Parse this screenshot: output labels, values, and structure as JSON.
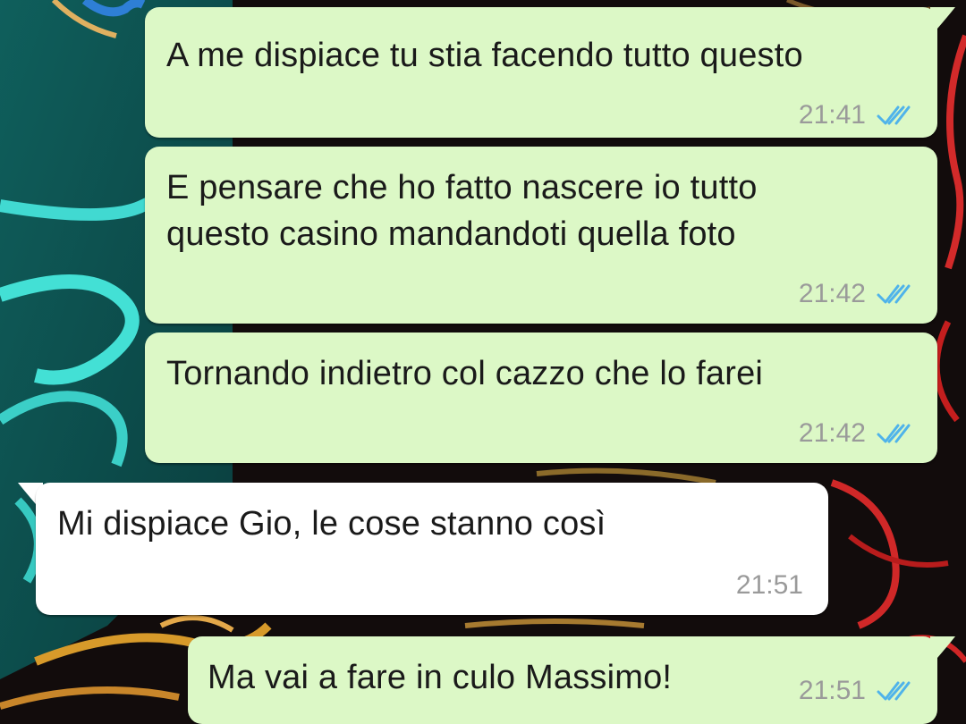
{
  "chat": {
    "messages": [
      {
        "direction": "outgoing",
        "text": "A me dispiace tu stia facendo tutto questo",
        "time": "21:41",
        "status_icon": "double-check-read-icon"
      },
      {
        "direction": "outgoing",
        "text": "E pensare che ho fatto nascere io tutto\nquesto casino mandandoti quella foto",
        "time": "21:42",
        "status_icon": "double-check-read-icon"
      },
      {
        "direction": "outgoing",
        "text": "Tornando indietro col cazzo che lo farei",
        "time": "21:42",
        "status_icon": "double-check-read-icon"
      },
      {
        "direction": "incoming",
        "text": "Mi dispiace Gio, le cose stanno così",
        "time": "21:51"
      },
      {
        "direction": "outgoing",
        "text": "Ma vai a fare in culo Massimo!",
        "time": "21:51",
        "status_icon": "double-check-read-icon"
      }
    ]
  },
  "colors": {
    "outgoing_bubble": "#dcf8c6",
    "incoming_bubble": "#ffffff",
    "read_tick": "#4fb3ea",
    "timestamp": "#9a9a9a"
  }
}
